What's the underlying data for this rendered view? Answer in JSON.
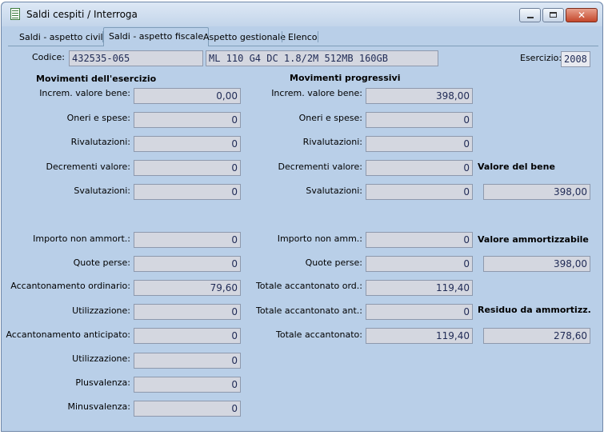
{
  "window": {
    "title": "Saldi cespiti / Interroga",
    "close_glyph": "✕"
  },
  "tabs": [
    {
      "label": "Saldi - aspetto civile",
      "active": false
    },
    {
      "label": "Saldi - aspetto fiscale",
      "active": true
    },
    {
      "label": "Aspetto gestionale",
      "active": false
    },
    {
      "label": "Elenco",
      "active": false
    }
  ],
  "header": {
    "codice_label": "Codice:",
    "codice_value": "432535-065",
    "descrizione_value": "ML 110 G4 DC 1.8/2M 512MB 160GB",
    "esercizio_label": "Esercizio:",
    "esercizio_value": "2008"
  },
  "esercizio": {
    "title": "Movimenti dell'esercizio",
    "rows": [
      {
        "label": "Increm. valore bene:",
        "value": "0,00"
      },
      {
        "label": "Oneri e spese:",
        "value": "0"
      },
      {
        "label": "Rivalutazioni:",
        "value": "0"
      },
      {
        "label": "Decrementi valore:",
        "value": "0"
      },
      {
        "label": "Svalutazioni:",
        "value": "0"
      },
      {
        "label": "Importo non ammort.:",
        "value": "0"
      },
      {
        "label": "Quote perse:",
        "value": "0"
      },
      {
        "label": "Accantonamento ordinario:",
        "value": "79,60"
      },
      {
        "label": "Utilizzazione:",
        "value": "0"
      },
      {
        "label": "Accantonamento anticipato:",
        "value": "0"
      },
      {
        "label": "Utilizzazione:",
        "value": "0"
      },
      {
        "label": "Plusvalenza:",
        "value": "0"
      },
      {
        "label": "Minusvalenza:",
        "value": "0"
      }
    ]
  },
  "progressivi": {
    "title": "Movimenti progressivi",
    "rows": [
      {
        "label": "Increm. valore bene:",
        "value": "398,00"
      },
      {
        "label": "Oneri e spese:",
        "value": "0"
      },
      {
        "label": "Rivalutazioni:",
        "value": "0"
      },
      {
        "label": "Decrementi valore:",
        "value": "0"
      },
      {
        "label": "Svalutazioni:",
        "value": "0"
      },
      {
        "label": "Importo non amm.:",
        "value": "0"
      },
      {
        "label": "Quote perse:",
        "value": "0"
      },
      {
        "label": "Totale accantonato ord.:",
        "value": "119,40"
      },
      {
        "label": "Totale accantonato ant.:",
        "value": "0"
      },
      {
        "label": "Totale accantonato:",
        "value": "119,40"
      }
    ]
  },
  "riepilogo": {
    "valore_bene_label": "Valore del bene",
    "valore_bene_value": "398,00",
    "valore_ammortizzabile_label": "Valore ammortizzabile",
    "valore_ammortizzabile_value": "398,00",
    "residuo_label": "Residuo da ammortizz.",
    "residuo_value": "278,60"
  }
}
